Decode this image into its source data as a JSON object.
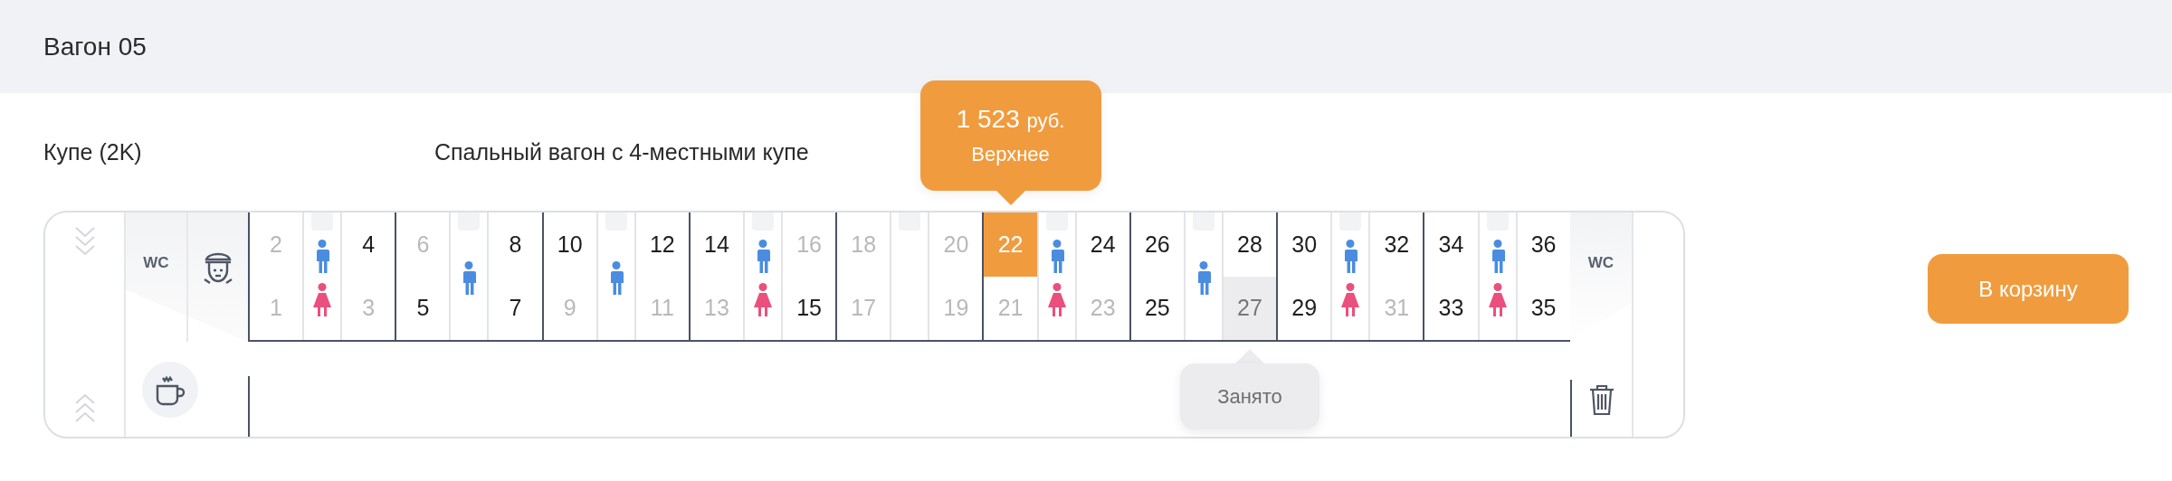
{
  "header": {
    "title": "Вагон 05"
  },
  "car_class": "Купе (2K)",
  "car_description": "Спальный вагон с 4-местными купе",
  "compartments": [
    {
      "seats": [
        {
          "number": "2",
          "available": false,
          "selected": false,
          "occupied": false
        },
        {
          "number": "4",
          "available": true,
          "selected": false,
          "occupied": false
        },
        {
          "number": "1",
          "available": false,
          "selected": false,
          "occupied": false
        },
        {
          "number": "3",
          "available": false,
          "selected": false,
          "occupied": false
        }
      ],
      "passengers": [
        {
          "kind": "male"
        },
        {
          "kind": "female"
        }
      ]
    },
    {
      "seats": [
        {
          "number": "6",
          "available": false,
          "selected": false,
          "occupied": false
        },
        {
          "number": "8",
          "available": true,
          "selected": false,
          "occupied": false
        },
        {
          "number": "5",
          "available": true,
          "selected": false,
          "occupied": false
        },
        {
          "number": "7",
          "available": true,
          "selected": false,
          "occupied": false
        }
      ],
      "passengers": [
        {
          "kind": "male"
        }
      ]
    },
    {
      "seats": [
        {
          "number": "10",
          "available": true,
          "selected": false,
          "occupied": false
        },
        {
          "number": "12",
          "available": true,
          "selected": false,
          "occupied": false
        },
        {
          "number": "9",
          "available": false,
          "selected": false,
          "occupied": false
        },
        {
          "number": "11",
          "available": false,
          "selected": false,
          "occupied": false
        }
      ],
      "passengers": [
        {
          "kind": "male"
        }
      ]
    },
    {
      "seats": [
        {
          "number": "14",
          "available": true,
          "selected": false,
          "occupied": false
        },
        {
          "number": "16",
          "available": false,
          "selected": false,
          "occupied": false
        },
        {
          "number": "13",
          "available": false,
          "selected": false,
          "occupied": false
        },
        {
          "number": "15",
          "available": true,
          "selected": false,
          "occupied": false
        }
      ],
      "passengers": [
        {
          "kind": "male"
        },
        {
          "kind": "female"
        }
      ]
    },
    {
      "seats": [
        {
          "number": "18",
          "available": false,
          "selected": false,
          "occupied": false
        },
        {
          "number": "20",
          "available": false,
          "selected": false,
          "occupied": false
        },
        {
          "number": "17",
          "available": false,
          "selected": false,
          "occupied": false
        },
        {
          "number": "19",
          "available": false,
          "selected": false,
          "occupied": false
        }
      ]
    },
    {
      "seats": [
        {
          "number": "22",
          "available": true,
          "selected": true,
          "occupied": false,
          "tooltip": {
            "price": "1 523",
            "currency": "руб.",
            "berth": "Верхнее"
          }
        },
        {
          "number": "24",
          "available": true,
          "selected": false,
          "occupied": false
        },
        {
          "number": "21",
          "available": false,
          "selected": false,
          "occupied": false
        },
        {
          "number": "23",
          "available": false,
          "selected": false,
          "occupied": false
        }
      ],
      "passengers": [
        {
          "kind": "male"
        },
        {
          "kind": "female"
        }
      ]
    },
    {
      "seats": [
        {
          "number": "26",
          "available": true,
          "selected": false,
          "occupied": false
        },
        {
          "number": "28",
          "available": true,
          "selected": false,
          "occupied": false
        },
        {
          "number": "25",
          "available": true,
          "selected": false,
          "occupied": false
        },
        {
          "number": "27",
          "available": false,
          "selected": false,
          "occupied": true,
          "tooltip": {
            "text": "Занято"
          }
        }
      ],
      "passengers": [
        {
          "kind": "male"
        }
      ]
    },
    {
      "seats": [
        {
          "number": "30",
          "available": true,
          "selected": false,
          "occupied": false
        },
        {
          "number": "32",
          "available": true,
          "selected": false,
          "occupied": false
        },
        {
          "number": "29",
          "available": true,
          "selected": false,
          "occupied": false
        },
        {
          "number": "31",
          "available": false,
          "selected": false,
          "occupied": false
        }
      ],
      "passengers": [
        {
          "kind": "male"
        },
        {
          "kind": "female"
        }
      ]
    },
    {
      "seats": [
        {
          "number": "34",
          "available": true,
          "selected": false,
          "occupied": false
        },
        {
          "number": "36",
          "available": true,
          "selected": false,
          "occupied": false
        },
        {
          "number": "33",
          "available": true,
          "selected": false,
          "occupied": false
        },
        {
          "number": "35",
          "available": true,
          "selected": false,
          "occupied": false
        }
      ],
      "passengers": [
        {
          "kind": "male"
        },
        {
          "kind": "female"
        }
      ]
    }
  ],
  "wc_left": "WC",
  "wc_right": "WC",
  "cart_button": "В корзину"
}
